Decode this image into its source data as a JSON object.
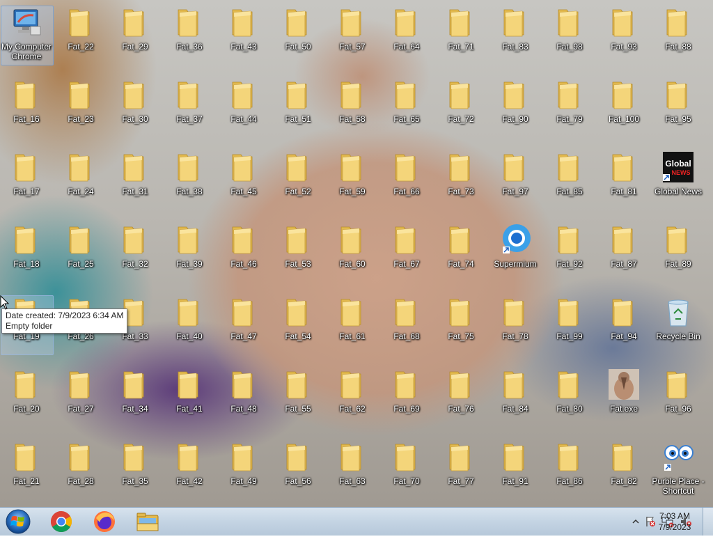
{
  "desktop": {
    "icons": [
      {
        "label": "My Computer Chrome",
        "type": "computer",
        "selected": true
      },
      {
        "label": "Fat_22",
        "type": "folder"
      },
      {
        "label": "Fat_29",
        "type": "folder"
      },
      {
        "label": "Fat_36",
        "type": "folder"
      },
      {
        "label": "Fat_43",
        "type": "folder"
      },
      {
        "label": "Fat_50",
        "type": "folder"
      },
      {
        "label": "Fat_57",
        "type": "folder"
      },
      {
        "label": "Fat_64",
        "type": "folder"
      },
      {
        "label": "Fat_71",
        "type": "folder"
      },
      {
        "label": "Fat_83",
        "type": "folder"
      },
      {
        "label": "Fat_98",
        "type": "folder"
      },
      {
        "label": "Fat_93",
        "type": "folder"
      },
      {
        "label": "Fat_88",
        "type": "folder"
      },
      {
        "label": "Fat_16",
        "type": "folder"
      },
      {
        "label": "Fat_23",
        "type": "folder"
      },
      {
        "label": "Fat_30",
        "type": "folder"
      },
      {
        "label": "Fat_37",
        "type": "folder"
      },
      {
        "label": "Fat_44",
        "type": "folder"
      },
      {
        "label": "Fat_51",
        "type": "folder"
      },
      {
        "label": "Fat_58",
        "type": "folder"
      },
      {
        "label": "Fat_65",
        "type": "folder"
      },
      {
        "label": "Fat_72",
        "type": "folder"
      },
      {
        "label": "Fat_90",
        "type": "folder"
      },
      {
        "label": "Fat_79",
        "type": "folder"
      },
      {
        "label": "Fat_100",
        "type": "folder"
      },
      {
        "label": "Fat_95",
        "type": "folder"
      },
      {
        "label": "Fat_17",
        "type": "folder"
      },
      {
        "label": "Fat_24",
        "type": "folder"
      },
      {
        "label": "Fat_31",
        "type": "folder"
      },
      {
        "label": "Fat_38",
        "type": "folder"
      },
      {
        "label": "Fat_45",
        "type": "folder"
      },
      {
        "label": "Fat_52",
        "type": "folder"
      },
      {
        "label": "Fat_59",
        "type": "folder"
      },
      {
        "label": "Fat_66",
        "type": "folder"
      },
      {
        "label": "Fat_73",
        "type": "folder"
      },
      {
        "label": "Fat_97",
        "type": "folder"
      },
      {
        "label": "Fat_85",
        "type": "folder"
      },
      {
        "label": "Fat_81",
        "type": "folder"
      },
      {
        "label": "Global News",
        "type": "globalnews",
        "logo_text": "Global NEWS"
      },
      {
        "label": "Fat_18",
        "type": "folder"
      },
      {
        "label": "Fat_25",
        "type": "folder"
      },
      {
        "label": "Fat_32",
        "type": "folder"
      },
      {
        "label": "Fat_39",
        "type": "folder"
      },
      {
        "label": "Fat_46",
        "type": "folder"
      },
      {
        "label": "Fat_53",
        "type": "folder"
      },
      {
        "label": "Fat_60",
        "type": "folder"
      },
      {
        "label": "Fat_67",
        "type": "folder"
      },
      {
        "label": "Fat_74",
        "type": "folder"
      },
      {
        "label": "Supermium",
        "type": "supermium"
      },
      {
        "label": "Fat_92",
        "type": "folder"
      },
      {
        "label": "Fat_87",
        "type": "folder"
      },
      {
        "label": "Fat_89",
        "type": "folder"
      },
      {
        "label": "Fat_19",
        "type": "folder",
        "hover": true
      },
      {
        "label": "Fat_26",
        "type": "folder"
      },
      {
        "label": "Fat_33",
        "type": "folder"
      },
      {
        "label": "Fat_40",
        "type": "folder"
      },
      {
        "label": "Fat_47",
        "type": "folder"
      },
      {
        "label": "Fat_54",
        "type": "folder"
      },
      {
        "label": "Fat_61",
        "type": "folder"
      },
      {
        "label": "Fat_68",
        "type": "folder"
      },
      {
        "label": "Fat_75",
        "type": "folder"
      },
      {
        "label": "Fat_78",
        "type": "folder"
      },
      {
        "label": "Fat_99",
        "type": "folder"
      },
      {
        "label": "Fat_94",
        "type": "folder"
      },
      {
        "label": "Recycle Bin",
        "type": "recycle"
      },
      {
        "label": "Fat_20",
        "type": "folder"
      },
      {
        "label": "Fat_27",
        "type": "folder"
      },
      {
        "label": "Fat_34",
        "type": "folder"
      },
      {
        "label": "Fat_41",
        "type": "folder"
      },
      {
        "label": "Fat_48",
        "type": "folder"
      },
      {
        "label": "Fat_55",
        "type": "folder"
      },
      {
        "label": "Fat_62",
        "type": "folder"
      },
      {
        "label": "Fat_69",
        "type": "folder"
      },
      {
        "label": "Fat_76",
        "type": "folder"
      },
      {
        "label": "Fat_84",
        "type": "folder"
      },
      {
        "label": "Fat_80",
        "type": "folder"
      },
      {
        "label": "Fat.exe",
        "type": "exe"
      },
      {
        "label": "Fat_96",
        "type": "folder"
      },
      {
        "label": "Fat_21",
        "type": "folder"
      },
      {
        "label": "Fat_28",
        "type": "folder"
      },
      {
        "label": "Fat_35",
        "type": "folder"
      },
      {
        "label": "Fat_42",
        "type": "folder"
      },
      {
        "label": "Fat_49",
        "type": "folder"
      },
      {
        "label": "Fat_56",
        "type": "folder"
      },
      {
        "label": "Fat_63",
        "type": "folder"
      },
      {
        "label": "Fat_70",
        "type": "folder"
      },
      {
        "label": "Fat_77",
        "type": "folder"
      },
      {
        "label": "Fat_91",
        "type": "folder"
      },
      {
        "label": "Fat_86",
        "type": "folder"
      },
      {
        "label": "Fat_82",
        "type": "folder"
      },
      {
        "label": "Purble Place - Shortcut",
        "type": "purble"
      }
    ]
  },
  "tooltip": {
    "line1": "Date created: 7/9/2023 6:34 AM",
    "line2": "Empty folder"
  },
  "taskbar": {
    "start_icon": "windows-start-orb-icon",
    "pinned": [
      "chrome-icon",
      "firefox-icon",
      "file-explorer-icon"
    ],
    "tray_icons": [
      "show-hidden-icons-chevron-icon",
      "action-center-flag-icon",
      "network-icon",
      "volume-muted-icon"
    ],
    "clock_time": "7:03 AM",
    "clock_date": "7/9/2023"
  },
  "colors": {
    "folder_front": "#f4d57a",
    "folder_back": "#e2b94e",
    "taskbar": "#c4d4e3"
  }
}
